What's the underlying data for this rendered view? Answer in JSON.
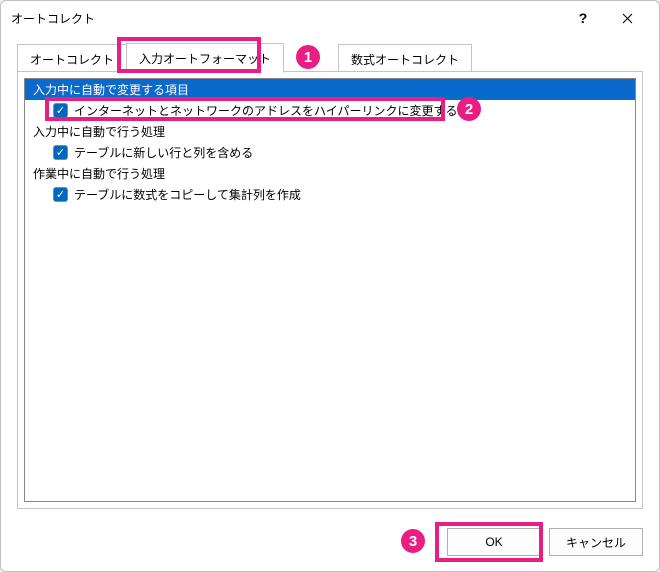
{
  "window": {
    "title": "オートコレクト"
  },
  "titlebar": {
    "help": "?",
    "close": "✕"
  },
  "tabs": {
    "t1": "オートコレクト",
    "t2": "入力オートフォーマット",
    "t3": "数式オートコレクト"
  },
  "groups": {
    "g1": {
      "label": "入力中に自動で変更する項目",
      "item1": "インターネットとネットワークのアドレスをハイパーリンクに変更する"
    },
    "g2": {
      "label": "入力中に自動で行う処理",
      "item1": "テーブルに新しい行と列を含める"
    },
    "g3": {
      "label": "作業中に自動で行う処理",
      "item1": "テーブルに数式をコピーして集計列を作成"
    }
  },
  "badges": {
    "b1": "1",
    "b2": "2",
    "b3": "3"
  },
  "footer": {
    "ok": "OK",
    "cancel": "キャンセル"
  },
  "colors": {
    "accent": "#e91e82",
    "selection": "#0a6acb",
    "checkbox": "#0067c0"
  }
}
